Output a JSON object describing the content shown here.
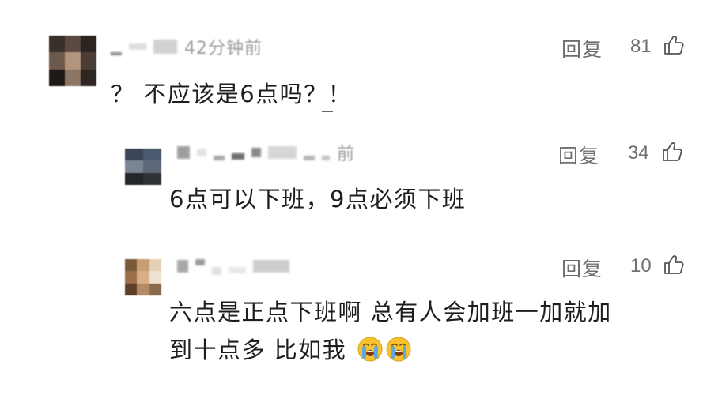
{
  "comments": [
    {
      "time_fragment": "42分钟前",
      "reply_label": "回复",
      "likes": "81",
      "text": "？ 不应该是6点吗？！",
      "icons": [
        "avatar",
        "thumbs-up-icon"
      ]
    },
    {
      "time_fragment": "前",
      "reply_label": "回复",
      "likes": "34",
      "text": "6点可以下班，9点必须下班",
      "icons": [
        "avatar",
        "thumbs-up-icon"
      ]
    },
    {
      "time_fragment": "",
      "reply_label": "回复",
      "likes": "10",
      "text_line1": "六点是正点下班啊 总有人会加班一加就加",
      "text_line2": "到十点多 比如我",
      "icons": [
        "avatar",
        "thumbs-up-icon",
        "loudly-crying-face-emoji",
        "loudly-crying-face-emoji"
      ]
    }
  ],
  "colors": {
    "text": "#1e1e1e",
    "secondary": "#6f6f6f",
    "censor": "#c9c9c9",
    "emoji_face": "#f7c22e",
    "emoji_tears": "#5aa9e6"
  }
}
